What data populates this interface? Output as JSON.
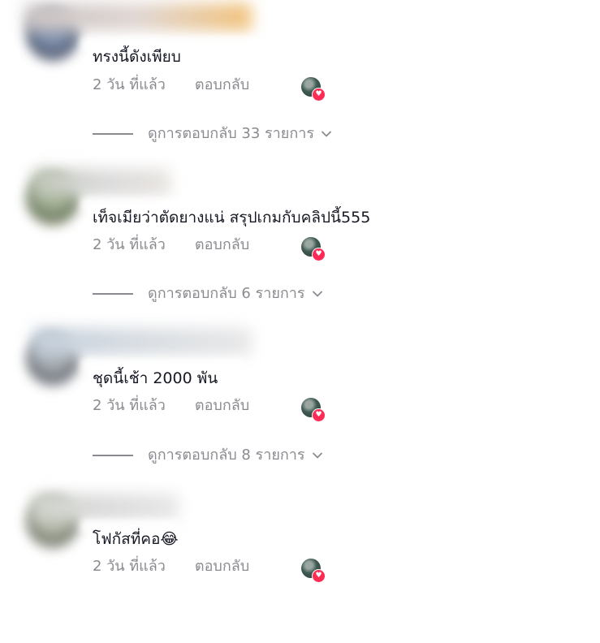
{
  "colors": {
    "text": "#161823",
    "secondary": "#8a8b91",
    "heart": "#fe2c55"
  },
  "comments": [
    {
      "text": "ทรงนี้ดังเพียบ",
      "time": "2 วัน ที่แล้ว",
      "reply": "ตอบกลับ",
      "view_replies": "ดูการตอบกลับ 33 รายการ"
    },
    {
      "text": "เท็จเมียว่าตัดยางแน่ สรุปเกมกับคลิปนี้555",
      "time": "2 วัน ที่แล้ว",
      "reply": "ตอบกลับ",
      "view_replies": "ดูการตอบกลับ 6 รายการ"
    },
    {
      "text": "ชุดนี้เช้า 2000 พัน",
      "time": "2 วัน ที่แล้ว",
      "reply": "ตอบกลับ",
      "view_replies": "ดูการตอบกลับ 8 รายการ"
    },
    {
      "text": "โฟกัสที่คอ😂",
      "time": "2 วัน ที่แล้ว",
      "reply": "ตอบกลับ",
      "view_replies": ""
    }
  ]
}
